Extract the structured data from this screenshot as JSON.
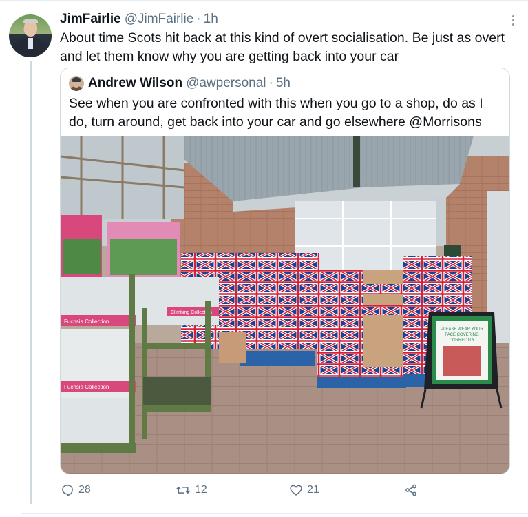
{
  "tweet": {
    "author_name": "JimFairlie",
    "author_handle": "@JimFairlie",
    "separator": "·",
    "time": "1h",
    "text": "About time Scots hit back at this kind of overt socialisation. Be just as overt and let them know why you are getting back into your car"
  },
  "quoted_tweet": {
    "author_name": "Andrew Wilson",
    "author_handle": "@awpersonal",
    "separator": "·",
    "time": "5h",
    "text": "See when you are confronted with this when you go to a shop, do as I do, turn around, get back into your car and go elsewhere @Morrisons"
  },
  "photo_signs": {
    "fuchsia_1": "Fuchsia Collection",
    "fuchsia_2": "Fuchsia Collection",
    "climbing": "Climbing Collection",
    "board_line1": "PLEASE WEAR YOUR",
    "board_line2": "FACE COVERING",
    "board_line3": "CORRECTLY"
  },
  "actions": {
    "reply_count": "28",
    "retweet_count": "12",
    "like_count": "21"
  },
  "icons": {
    "reply": "reply-icon",
    "retweet": "retweet-icon",
    "like": "heart-icon",
    "share": "share-icon",
    "more": "more-icon"
  },
  "colors": {
    "secondary_text": "#5b7083",
    "border": "#cfd9de"
  }
}
